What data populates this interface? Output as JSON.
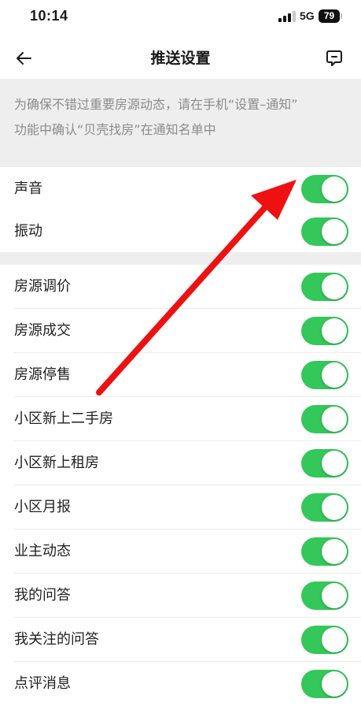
{
  "status_bar": {
    "time": "10:14",
    "network": "5G",
    "battery": "79"
  },
  "nav": {
    "title": "推送设置",
    "back_icon": "arrow-left-icon",
    "feedback_icon": "message-square-icon"
  },
  "notice": {
    "line1": "为确保不错过重要房源动态，请在手机“设置–通知”",
    "line2": "功能中确认“贝壳找房”在通知名单中"
  },
  "general_settings": [
    {
      "label": "声音",
      "enabled": true
    },
    {
      "label": "振动",
      "enabled": true
    }
  ],
  "push_types": [
    {
      "label": "房源调价",
      "enabled": true
    },
    {
      "label": "房源成交",
      "enabled": true
    },
    {
      "label": "房源停售",
      "enabled": true
    },
    {
      "label": "小区新上二手房",
      "enabled": true
    },
    {
      "label": "小区新上租房",
      "enabled": true
    },
    {
      "label": "小区月报",
      "enabled": true
    },
    {
      "label": "业主动态",
      "enabled": true
    },
    {
      "label": "我的问答",
      "enabled": true
    },
    {
      "label": "我关注的问答",
      "enabled": true
    },
    {
      "label": "点评消息",
      "enabled": true
    }
  ],
  "colors": {
    "toggle_on": "#34c759",
    "annotation_arrow": "#ee1111",
    "section_background": "#eeeeee"
  }
}
